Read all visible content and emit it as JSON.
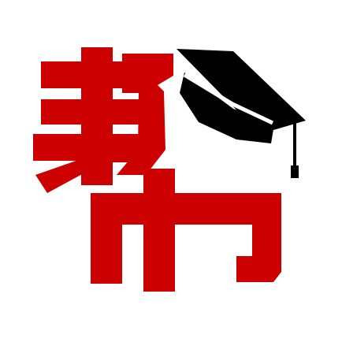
{
  "logo": {
    "glyph_text": "帮",
    "glyph_icon": "bang-character-logo-icon",
    "cap_icon": "graduation-cap-icon"
  },
  "colors": {
    "background": "#ffffff",
    "glyph": "#cc0000",
    "cap": "#000000"
  }
}
